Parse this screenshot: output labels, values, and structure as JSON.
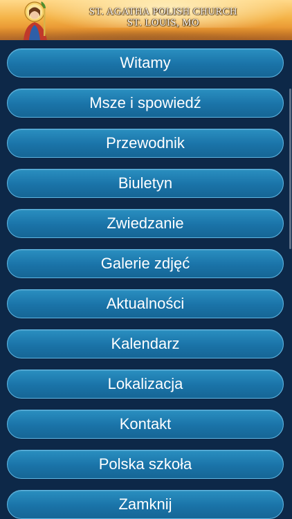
{
  "banner": {
    "line1": "ST. AGATHA POLISH CHURCH",
    "line2": "ST. LOUIS, MO",
    "saint_icon": "saint-agatha-portrait"
  },
  "menu": {
    "items": [
      {
        "label": "Witamy"
      },
      {
        "label": "Msze i spowiedź"
      },
      {
        "label": "Przewodnik"
      },
      {
        "label": "Biuletyn"
      },
      {
        "label": "Zwiedzanie"
      },
      {
        "label": "Galerie zdjęć"
      },
      {
        "label": "Aktualności"
      },
      {
        "label": "Kalendarz"
      },
      {
        "label": "Lokalizacja"
      },
      {
        "label": "Kontakt"
      },
      {
        "label": "Polska szkoła"
      },
      {
        "label": "Zamknij"
      }
    ]
  },
  "colors": {
    "background": "#0d2848",
    "button": "#1a73a8",
    "button_border": "#5fb7e3",
    "banner": "#f4b347"
  }
}
